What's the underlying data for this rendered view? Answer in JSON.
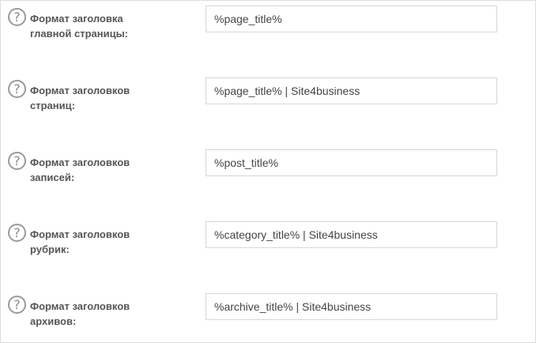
{
  "settings": {
    "rows": [
      {
        "help_glyph": "?",
        "help_icon": "question-circle-icon",
        "label_line1": "Формат заголовка",
        "label_line2": "главной страницы:",
        "value": "%page_title%"
      },
      {
        "help_glyph": "?",
        "help_icon": "question-circle-icon",
        "label_line1": "Формат заголовков",
        "label_line2": "страниц:",
        "value": "%page_title% | Site4business"
      },
      {
        "help_glyph": "?",
        "help_icon": "question-circle-icon",
        "label_line1": "Формат заголовков",
        "label_line2": "записей:",
        "value": "%post_title%"
      },
      {
        "help_glyph": "?",
        "help_icon": "question-circle-icon",
        "label_line1": "Формат заголовков",
        "label_line2": "рубрик:",
        "value": "%category_title% | Site4business"
      },
      {
        "help_glyph": "?",
        "help_icon": "question-circle-icon",
        "label_line1": "Формат заголовков",
        "label_line2": "архивов:",
        "value": "%archive_title% | Site4business"
      }
    ]
  }
}
